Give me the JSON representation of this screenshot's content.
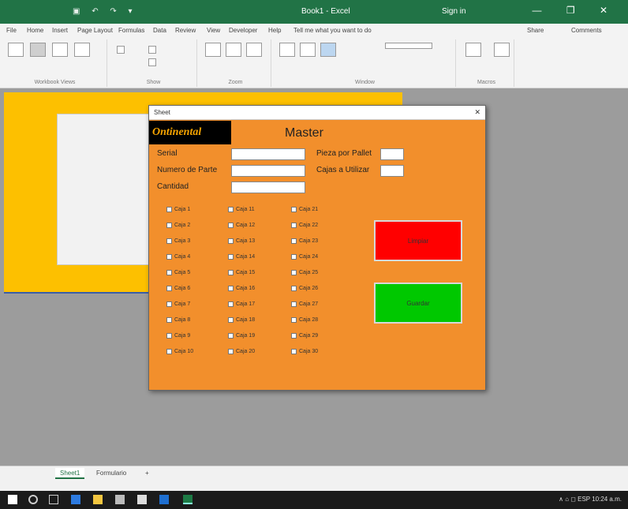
{
  "window": {
    "quick_access": "▣ ↶ ↷ ▾",
    "title": "Book1 - Excel",
    "user": "Sign in",
    "controls": "—  ❐  ✕"
  },
  "ribbon": {
    "tabs": [
      "File",
      "Home",
      "Insert",
      "Page Layout",
      "Formulas",
      "Data",
      "Review",
      "View",
      "Developer",
      "Help",
      "Tell me what you want to do"
    ],
    "share": "Share",
    "comments": "Comments",
    "groups": [
      "Workbook Views",
      "Show",
      "Zoom",
      "Window",
      "Macros"
    ]
  },
  "sheet": {
    "tabs": [
      "Sheet1",
      "Formulario"
    ],
    "add": "+"
  },
  "dialog": {
    "title": "Sheet",
    "close": "✕",
    "logo_text": "Ontinental",
    "header": "Master",
    "fields": {
      "serial": {
        "label": "Serial",
        "value": ""
      },
      "numero_parte": {
        "label": "Numero de Parte",
        "value": ""
      },
      "cantidad": {
        "label": "Cantidad",
        "value": ""
      },
      "piezas_por_pallet": {
        "label": "Pieza por Pallet",
        "value": ""
      },
      "cajas_utilizar": {
        "label": "Cajas a Utilizar",
        "value": ""
      }
    },
    "checkboxes": {
      "col1": [
        "Caja 1",
        "Caja 2",
        "Caja 3",
        "Caja 4",
        "Caja 5",
        "Caja 6",
        "Caja 7",
        "Caja 8",
        "Caja 9",
        "Caja 10"
      ],
      "col2": [
        "Caja 11",
        "Caja 12",
        "Caja 13",
        "Caja 14",
        "Caja 15",
        "Caja 16",
        "Caja 17",
        "Caja 18",
        "Caja 19",
        "Caja 20"
      ],
      "col3": [
        "Caja 21",
        "Caja 22",
        "Caja 23",
        "Caja 24",
        "Caja 25",
        "Caja 26",
        "Caja 27",
        "Caja 28",
        "Caja 29",
        "Caja 30"
      ]
    },
    "red_button_label": "Limpiar",
    "green_button_label": "Guardar"
  },
  "taskbar": {
    "tray": "∧  ⌂ ◻  ESP  10:24 a.m."
  },
  "colors": {
    "excel_green": "#217346",
    "form_orange": "#f28f2c",
    "sheet_yellow": "#fdc000",
    "red_button": "#ff0000",
    "green_button": "#00c800"
  }
}
